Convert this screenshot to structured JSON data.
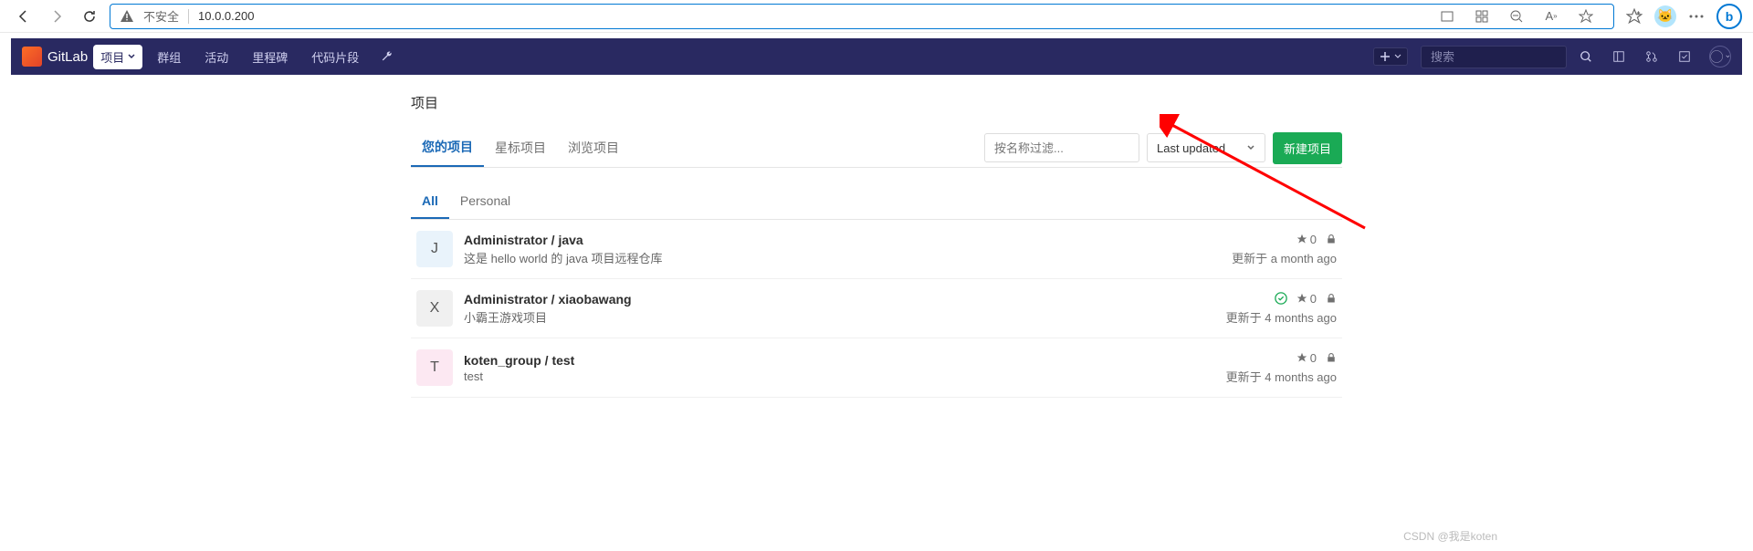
{
  "browser": {
    "security_label": "不安全",
    "url": "10.0.0.200"
  },
  "gitlab_header": {
    "brand": "GitLab",
    "project_dropdown": "项目",
    "nav": {
      "groups": "群组",
      "activity": "活动",
      "milestones": "里程碑",
      "snippets": "代码片段"
    },
    "search_placeholder": "搜索"
  },
  "page": {
    "title": "项目",
    "tabs": {
      "your_projects": "您的项目",
      "starred": "星标项目",
      "explore": "浏览项目"
    },
    "filter_placeholder": "按名称过滤...",
    "sort_label": "Last updated",
    "new_project": "新建项目",
    "sub_tabs": {
      "all": "All",
      "personal": "Personal"
    }
  },
  "projects": [
    {
      "letter": "J",
      "avatar_bg": "#e9f3fb",
      "name": "Administrator / java",
      "desc": "这是 hello world 的 java 项目远程仓库",
      "has_check": false,
      "stars": "0",
      "updated": "更新于 a month ago"
    },
    {
      "letter": "X",
      "avatar_bg": "#f0f0f0",
      "name": "Administrator / xiaobawang",
      "desc": "小霸王游戏项目",
      "has_check": true,
      "stars": "0",
      "updated": "更新于 4 months ago"
    },
    {
      "letter": "T",
      "avatar_bg": "#fce8f2",
      "name": "koten_group / test",
      "desc": "test",
      "has_check": false,
      "stars": "0",
      "updated": "更新于 4 months ago"
    }
  ],
  "watermark": "CSDN @我是koten"
}
